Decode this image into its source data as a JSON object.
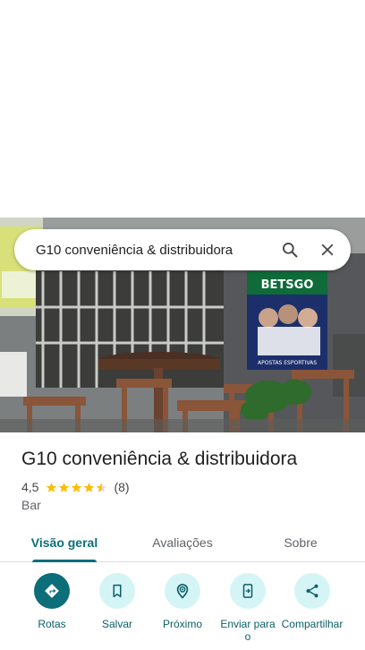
{
  "search": {
    "query": "G10 conveniência & distribuidora"
  },
  "place": {
    "name": "G10 conveniência & distribuidora",
    "rating": "4,5",
    "rating_value": 4.5,
    "review_count": "(8)",
    "category": "Bar"
  },
  "tabs": [
    {
      "label": "Visão geral",
      "active": true
    },
    {
      "label": "Avaliações",
      "active": false
    },
    {
      "label": "Sobre",
      "active": false
    }
  ],
  "actions": [
    {
      "label": "Rotas",
      "icon": "directions-icon"
    },
    {
      "label": "Salvar",
      "icon": "bookmark-icon"
    },
    {
      "label": "Próximo",
      "icon": "nearby-icon"
    },
    {
      "label": "Enviar para o",
      "icon": "send-to-phone-icon"
    },
    {
      "label": "Compartilhar",
      "icon": "share-icon"
    }
  ],
  "photo": {
    "banner_text": "BETSGO",
    "banner_subtext": "APOSTAS ESPORTIVAS"
  },
  "colors": {
    "accent": "#0b6e79",
    "action_circle": "#d5f4f6",
    "star": "#fbbc04"
  }
}
